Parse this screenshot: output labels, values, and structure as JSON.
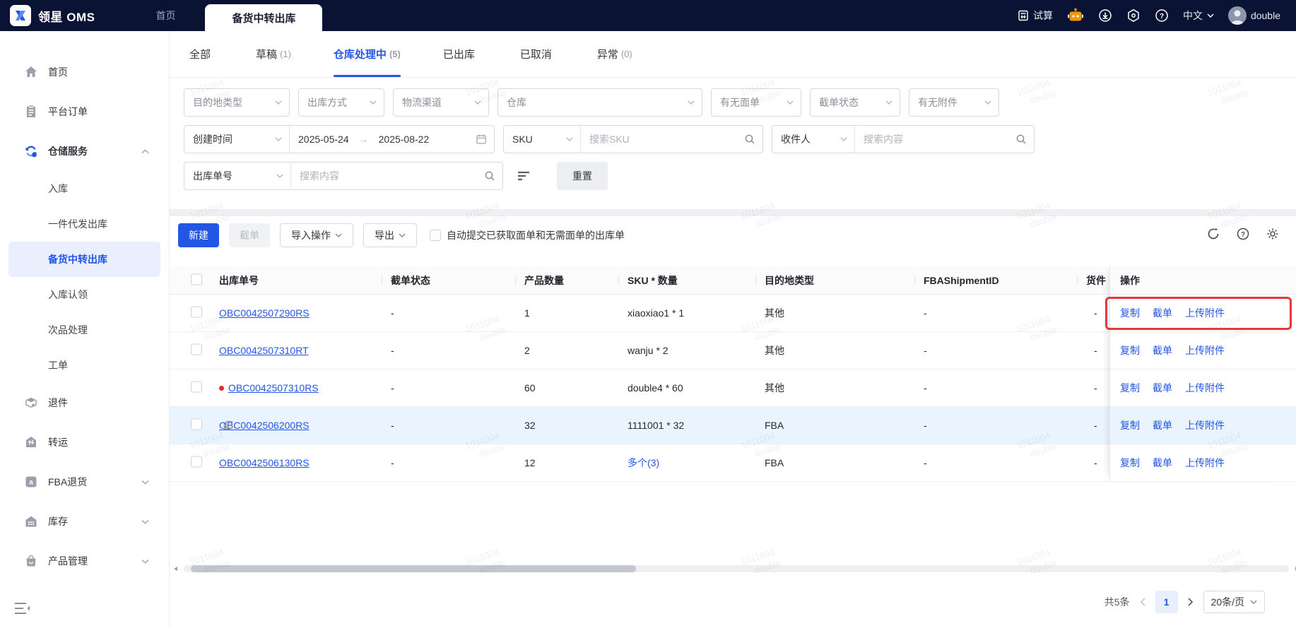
{
  "topbar": {
    "brand": "领星 OMS",
    "home_tab": "首页",
    "active_tab": "备货中转出库",
    "trial": "试算",
    "lang": "中文",
    "user": "double"
  },
  "sidebar": {
    "items": [
      {
        "label": "首页"
      },
      {
        "label": "平台订单"
      },
      {
        "label": "仓储服务"
      },
      {
        "label": "退件"
      },
      {
        "label": "转运"
      },
      {
        "label": "FBA退货"
      },
      {
        "label": "库存"
      },
      {
        "label": "产品管理"
      }
    ],
    "sub_items": [
      {
        "label": "入库"
      },
      {
        "label": "一件代发出库"
      },
      {
        "label": "备货中转出库"
      },
      {
        "label": "入库认领"
      },
      {
        "label": "次品处理"
      },
      {
        "label": "工单"
      }
    ]
  },
  "status_tabs": [
    {
      "label": "全部",
      "count": ""
    },
    {
      "label": "草稿",
      "count": "(1)"
    },
    {
      "label": "仓库处理中",
      "count": "(5)"
    },
    {
      "label": "已出库",
      "count": ""
    },
    {
      "label": "已取消",
      "count": ""
    },
    {
      "label": "异常",
      "count": "(0)"
    }
  ],
  "filters": {
    "selects": [
      {
        "label": "目的地类型"
      },
      {
        "label": "出库方式"
      },
      {
        "label": "物流渠道"
      },
      {
        "label": "仓库"
      },
      {
        "label": "有无面单"
      },
      {
        "label": "截单状态"
      },
      {
        "label": "有无附件"
      }
    ],
    "date": {
      "label": "创建时间",
      "start": "2025-05-24",
      "arrow": "→",
      "end": "2025-08-22"
    },
    "sku": {
      "label": "SKU",
      "placeholder": "搜索SKU"
    },
    "recipient": {
      "label": "收件人",
      "placeholder": "搜索内容"
    },
    "order": {
      "label": "出库单号",
      "placeholder": "搜索内容"
    },
    "reset": "重置"
  },
  "toolbar": {
    "new": "新建",
    "cut": "截单",
    "import": "导入操作",
    "export": "导出",
    "auto_label": "自动提交已获取面单和无需面单的出库单"
  },
  "table": {
    "headers": [
      "出库单号",
      "截单状态",
      "产品数量",
      "SKU * 数量",
      "目的地类型",
      "FBAShipmentID",
      "货件",
      "操作"
    ],
    "actions": [
      "复制",
      "截单",
      "上传附件"
    ],
    "rows": [
      {
        "order_no": "OBC0042507290RS",
        "cut_status": "-",
        "qty": "1",
        "sku": "xiaoxiao1 * 1",
        "dest": "其他",
        "fba": "-",
        "shipment": "-"
      },
      {
        "order_no": "OBC0042507310RT",
        "cut_status": "-",
        "qty": "2",
        "sku": "wanju * 2",
        "dest": "其他",
        "fba": "-",
        "shipment": "-"
      },
      {
        "order_no": "OBC0042507310RS",
        "cut_status": "-",
        "qty": "60",
        "sku": "double4 * 60",
        "dest": "其他",
        "fba": "-",
        "shipment": "-"
      },
      {
        "order_no": "OBC0042506200RS",
        "cut_status": "-",
        "qty": "32",
        "sku": "1111001 * 32",
        "dest": "FBA",
        "fba": "-",
        "shipment": "-"
      },
      {
        "order_no": "OBC0042506130RS",
        "cut_status": "-",
        "qty": "12",
        "sku": "多个(3)",
        "dest": "FBA",
        "fba": "-",
        "shipment": "-"
      }
    ]
  },
  "pagination": {
    "total": "共5条",
    "page": "1",
    "size": "20条/页"
  },
  "watermark": {
    "line1": "1011004",
    "line2": "double"
  },
  "colors": {
    "primary": "#2456e6",
    "danger": "#e5383b",
    "topbar_bg": "#0b1334",
    "row_highlight": "#eaf4fe"
  }
}
